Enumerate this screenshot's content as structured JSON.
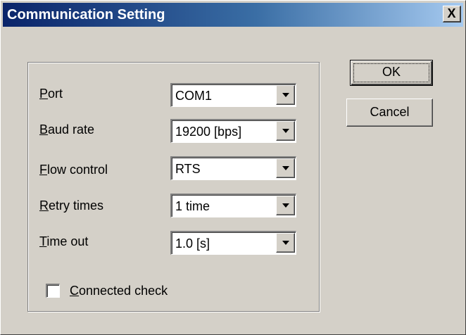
{
  "window": {
    "title": "Communication Setting",
    "close_glyph": "X"
  },
  "settings": [
    {
      "accel": "P",
      "label_rest": "ort",
      "value": "COM1"
    },
    {
      "accel": "B",
      "label_rest": "aud rate",
      "value": "19200 [bps]"
    },
    {
      "accel": "F",
      "label_rest": "low control",
      "value": "RTS"
    },
    {
      "accel": "R",
      "label_rest": "etry times",
      "value": "1 time"
    },
    {
      "accel": "T",
      "label_rest": "ime out",
      "value": "1.0 [s]"
    }
  ],
  "connected_check": {
    "accel": "C",
    "label_rest": "onnected check",
    "checked": false
  },
  "buttons": {
    "ok_label": "OK",
    "cancel_label": "Cancel"
  },
  "icons": {
    "dropdown": "chevron-down-icon",
    "close": "close-icon"
  }
}
